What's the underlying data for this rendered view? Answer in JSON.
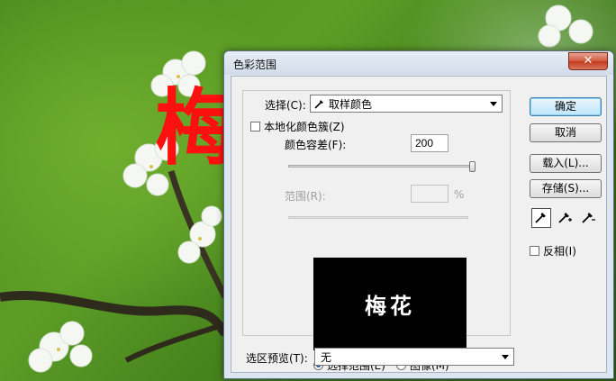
{
  "dialog": {
    "title": "色彩范围",
    "close_label": "✕",
    "select_label": "选择(C):",
    "select_value": "取样颜色",
    "localized_label": "本地化颜色簇(Z)",
    "fuzziness_label": "颜色容差(F):",
    "fuzziness_value": "200",
    "fuzziness_fraction": 1.0,
    "range_label": "范围(R):",
    "range_value": "",
    "range_unit": "%",
    "preview_text": "梅花",
    "radio_selection_label": "选择范围(E)",
    "radio_image_label": "图像(M)",
    "radio_selected": "selection",
    "selection_preview_label": "选区预览(T):",
    "selection_preview_value": "无",
    "ok_label": "确定",
    "cancel_label": "取消",
    "load_label": "载入(L)...",
    "save_label": "存储(S)...",
    "invert_label": "反相(I)",
    "eyedroppers": [
      "eyedropper-icon",
      "eyedropper-plus-icon",
      "eyedropper-minus-icon"
    ]
  },
  "background": {
    "red_character": "梅"
  }
}
